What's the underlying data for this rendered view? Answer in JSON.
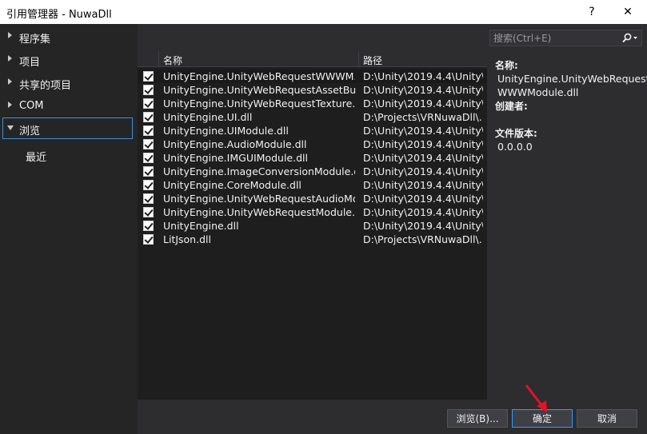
{
  "window": {
    "title": "引用管理器 - NuwaDll",
    "help": "?",
    "close": "✕"
  },
  "nav": {
    "items": [
      {
        "label": "程序集"
      },
      {
        "label": "项目"
      },
      {
        "label": "共享的项目"
      },
      {
        "label": "COM"
      },
      {
        "label": "浏览"
      },
      {
        "label": "最近"
      }
    ]
  },
  "list": {
    "headers": {
      "name": "名称",
      "path": "路径"
    },
    "rows": [
      {
        "name": "UnityEngine.UnityWebRequestWWWM...",
        "path": "D:\\Unity\\2019.4.4\\Unity\\...",
        "checked": true
      },
      {
        "name": "UnityEngine.UnityWebRequestAssetBun...",
        "path": "D:\\Unity\\2019.4.4\\Unity\\...",
        "checked": true
      },
      {
        "name": "UnityEngine.UnityWebRequestTexture...",
        "path": "D:\\Unity\\2019.4.4\\Unity\\...",
        "checked": true
      },
      {
        "name": "UnityEngine.UI.dll",
        "path": "D:\\Projects\\VRNuwaDll\\...",
        "checked": true
      },
      {
        "name": "UnityEngine.UIModule.dll",
        "path": "D:\\Unity\\2019.4.4\\Unity\\...",
        "checked": true
      },
      {
        "name": "UnityEngine.AudioModule.dll",
        "path": "D:\\Unity\\2019.4.4\\Unity\\...",
        "checked": true
      },
      {
        "name": "UnityEngine.IMGUIModule.dll",
        "path": "D:\\Unity\\2019.4.4\\Unity\\...",
        "checked": true
      },
      {
        "name": "UnityEngine.ImageConversionModule.dll",
        "path": "D:\\Unity\\2019.4.4\\Unity\\...",
        "checked": true
      },
      {
        "name": "UnityEngine.CoreModule.dll",
        "path": "D:\\Unity\\2019.4.4\\Unity\\...",
        "checked": true
      },
      {
        "name": "UnityEngine.UnityWebRequestAudioMo...",
        "path": "D:\\Unity\\2019.4.4\\Unity\\...",
        "checked": true
      },
      {
        "name": "UnityEngine.UnityWebRequestModule.dll",
        "path": "D:\\Unity\\2019.4.4\\Unity\\...",
        "checked": true
      },
      {
        "name": "UnityEngine.dll",
        "path": "D:\\Unity\\2019.4.4\\Unity\\...",
        "checked": true
      },
      {
        "name": "LitJson.dll",
        "path": "D:\\Projects\\VRNuwaDll\\...",
        "checked": true
      }
    ]
  },
  "search": {
    "placeholder": "搜索(Ctrl+E)"
  },
  "details": {
    "name_label": "名称:",
    "name_line1": "UnityEngine.UnityWebRequest",
    "name_line2": "WWWModule.dll",
    "creator_label": "创建者:",
    "version_label": "文件版本:",
    "version_value": "0.0.0.0"
  },
  "buttons": {
    "browse": "浏览(B)...",
    "ok": "确定",
    "cancel": "取消"
  },
  "colors": {
    "accent": "#3399ff",
    "annotation_arrow": "#e81123"
  }
}
